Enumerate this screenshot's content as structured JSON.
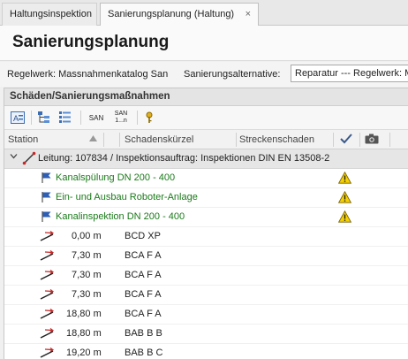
{
  "tabs": [
    {
      "label": "Haltungsinspektion"
    },
    {
      "label": "Sanierungsplanung (Haltung)",
      "close": "×"
    }
  ],
  "page_title": "Sanierungsplanung",
  "regelwerk": {
    "label": "Regelwerk: Massnahmenkatalog San",
    "alt_label": "Sanierungsalternative:",
    "alt_value": "Reparatur --- Regelwerk: M"
  },
  "panel_title": "Schäden/Sanierungsmaßnahmen",
  "toolbar": {
    "san_label": "SAN",
    "san_range_top": "SAN",
    "san_range_bottom": "1...n"
  },
  "columns": {
    "station": "Station",
    "kuerzel": "Schadenskürzel",
    "strecken": "Streckenschaden"
  },
  "group": {
    "label": "Leitung: 107834 / Inspektionsauftrag: Inspektionen DIN EN 13508-2"
  },
  "measures": [
    {
      "label": "Kanalspülung DN 200 - 400"
    },
    {
      "label": "Ein- und Ausbau Roboter-Anlage"
    },
    {
      "label": "Kanalinspektion DN 200 - 400"
    }
  ],
  "damages": [
    {
      "station": "0,00 m",
      "code": "BCD XP"
    },
    {
      "station": "7,30 m",
      "code": "BCA F A"
    },
    {
      "station": "7,30 m",
      "code": "BCA F A"
    },
    {
      "station": "7,30 m",
      "code": "BCA F A"
    },
    {
      "station": "18,80 m",
      "code": "BCA F A"
    },
    {
      "station": "18,80 m",
      "code": "BAB B B"
    },
    {
      "station": "19,20 m",
      "code": "BAB B C"
    }
  ],
  "colors": {
    "accent_green": "#1a7a1a",
    "warning_yellow": "#f5d000",
    "flag_blue": "#2e5fb4"
  }
}
